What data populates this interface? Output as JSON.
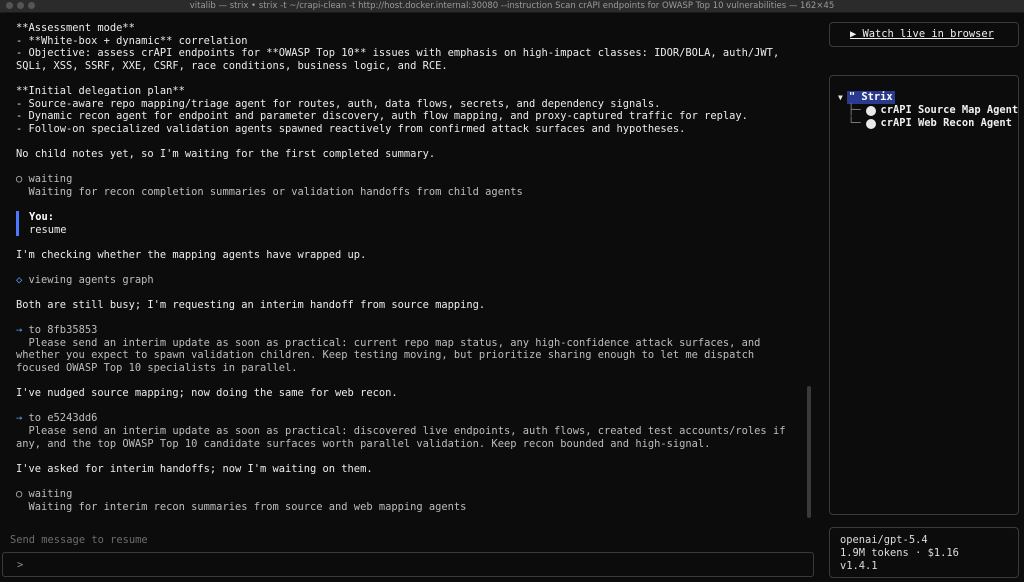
{
  "window": {
    "title": "vitalib — strix • strix -t ~/crapi-clean -t http://host.docker.internal:30080 --instruction Scan crAPI endpoints for OWASP Top 10 vulnerabilities — 162×45"
  },
  "chat": {
    "block1": [
      "**Assessment mode**",
      "- **White-box + dynamic** correlation",
      "- Objective: assess crAPI endpoints for **OWASP Top 10** issues with emphasis on high-impact classes: IDOR/BOLA, auth/JWT,",
      "SQLi, XSS, SSRF, XXE, CSRF, race conditions, business logic, and RCE."
    ],
    "block2": [
      "**Initial delegation plan**",
      "- Source-aware repo mapping/triage agent for routes, auth, data flows, secrets, and dependency signals.",
      "- Dynamic recon agent for endpoint and parameter discovery, auth flow mapping, and proxy-captured traffic for replay.",
      "- Follow-on specialized validation agents spawned reactively from confirmed attack surfaces and hypotheses."
    ],
    "msg_no_child": "No child notes yet, so I'm waiting for the first completed summary.",
    "wait1": {
      "icon": "○",
      "status": "waiting",
      "detail": "Waiting for recon completion summaries or validation handoffs from child agents"
    },
    "user": {
      "label": "You:",
      "text": "resume"
    },
    "msg_checking": "I'm checking whether the mapping agents have wrapped up.",
    "tool_view": {
      "icon": "◇",
      "text": "viewing agents graph"
    },
    "msg_busy": "Both are still busy; I'm requesting an interim handoff from source mapping.",
    "send1": {
      "arrow": "→",
      "to": "to 8fb35853",
      "lines": [
        "Please send an interim update as soon as practical: current repo map status, any high-confidence attack surfaces, and",
        "whether you expect to spawn validation children. Keep testing moving, but prioritize sharing enough to let me dispatch",
        "focused OWASP Top 10 specialists in parallel."
      ]
    },
    "msg_nudged": "I've nudged source mapping; now doing the same for web recon.",
    "send2": {
      "arrow": "→",
      "to": "to e5243dd6",
      "lines": [
        "Please send an interim update as soon as practical: discovered live endpoints, auth flows, created test accounts/roles if",
        "any, and the top OWASP Top 10 candidate surfaces worth parallel validation. Keep recon bounded and high-signal."
      ]
    },
    "msg_asked": "I've asked for interim handoffs; now I'm waiting on them.",
    "wait2": {
      "icon": "○",
      "status": "waiting",
      "detail": "Waiting for interim recon summaries from source and web mapping agents"
    }
  },
  "input": {
    "label": "Send message to resume",
    "prompt": ">"
  },
  "sidebar": {
    "watch_link": "▶ Watch live in browser",
    "tree": {
      "root_icon": "▼",
      "root_label": "\" Strix",
      "items": [
        {
          "branch": "├─",
          "label": "crAPI Source Map Agent"
        },
        {
          "branch": "└─",
          "label": "crAPI Web Recon Agent"
        }
      ]
    },
    "info": {
      "model": "openai/gpt-5.4",
      "usage": "1.9M tokens · $1.16",
      "version": "v1.4.1"
    }
  },
  "colors": {
    "accent": "#5ba3ff",
    "user_bar": "#4a7bff",
    "root_highlight": "#2a3b8f"
  }
}
